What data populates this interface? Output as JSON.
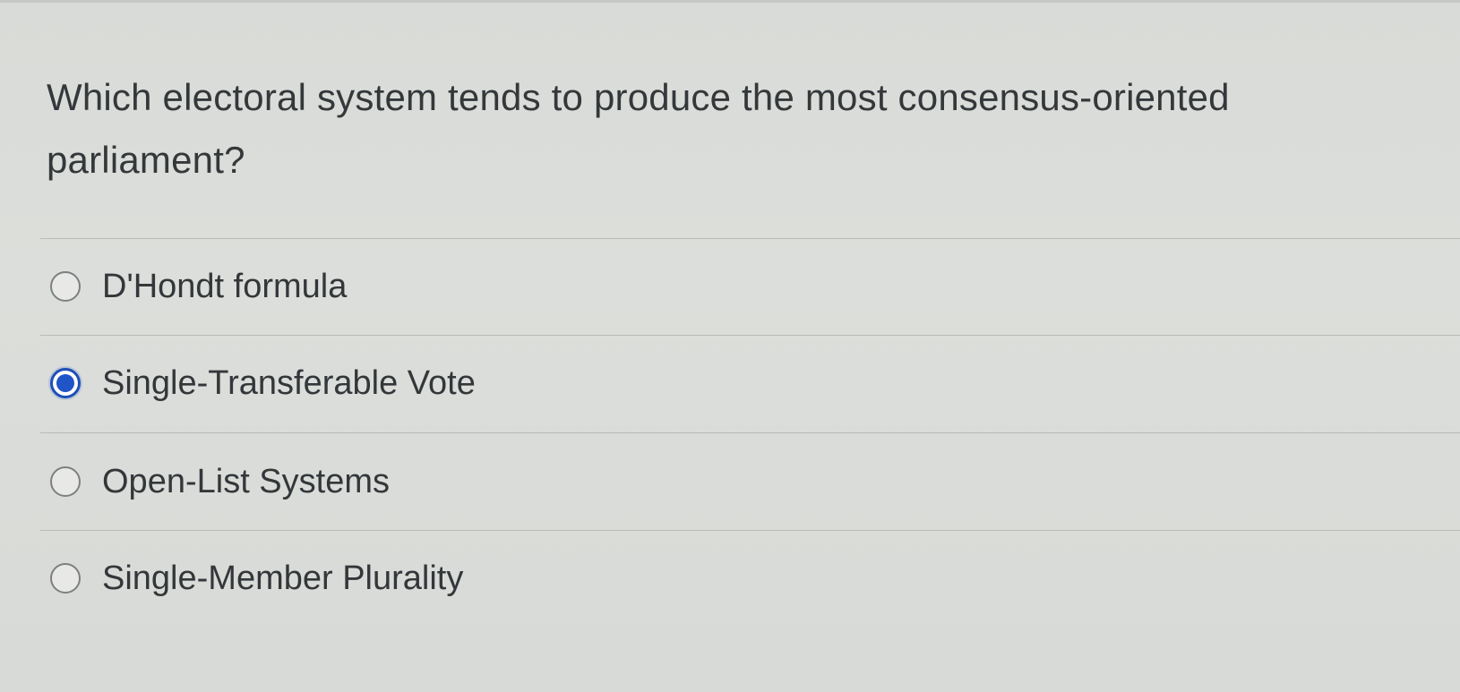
{
  "question": {
    "text": "Which electoral system tends to produce the most consensus-oriented parliament?"
  },
  "answers": [
    {
      "label": "D'Hondt formula",
      "selected": false
    },
    {
      "label": "Single-Transferable Vote",
      "selected": true
    },
    {
      "label": "Open-List Systems",
      "selected": false
    },
    {
      "label": "Single-Member Plurality",
      "selected": false
    }
  ],
  "colors": {
    "background": "#dadcd9",
    "text": "#34373a",
    "radio_selected": "#1f55c6",
    "divider": "#b9bbb9"
  },
  "icons": {
    "unselected": "radio-unchecked-icon",
    "selected": "radio-checked-icon"
  }
}
